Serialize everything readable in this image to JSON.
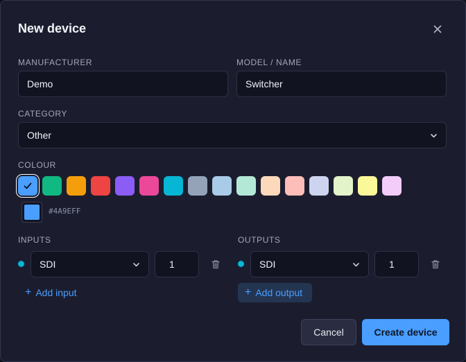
{
  "dialog": {
    "title": "New device"
  },
  "manufacturer": {
    "label": "MANUFACTURER",
    "value": "Demo"
  },
  "model": {
    "label": "MODEL / NAME",
    "value": "Switcher"
  },
  "category": {
    "label": "CATEGORY",
    "value": "Other"
  },
  "colour": {
    "label": "COLOUR",
    "swatches": [
      "#4a9eff",
      "#10b981",
      "#f59e0b",
      "#ef4444",
      "#8b5cf6",
      "#ec4899",
      "#06b6d4",
      "#94a3b8",
      "#a8cbe8",
      "#b4e8d6",
      "#fdd9bc",
      "#fdbdb8",
      "#cdd4f0",
      "#e3f3ca",
      "#fbf89a",
      "#f3ccf9"
    ],
    "selected_index": 0,
    "custom_hex": "#4A9EFF"
  },
  "inputs": {
    "label": "INPUTS",
    "rows": [
      {
        "type": "SDI",
        "count": "1"
      }
    ],
    "add_label": "Add input"
  },
  "outputs": {
    "label": "OUTPUTS",
    "rows": [
      {
        "type": "SDI",
        "count": "1"
      }
    ],
    "add_label": "Add output"
  },
  "actions": {
    "cancel": "Cancel",
    "create": "Create device"
  },
  "colors": {
    "accent": "#4a9eff",
    "port_dot": "#06b6d4"
  }
}
